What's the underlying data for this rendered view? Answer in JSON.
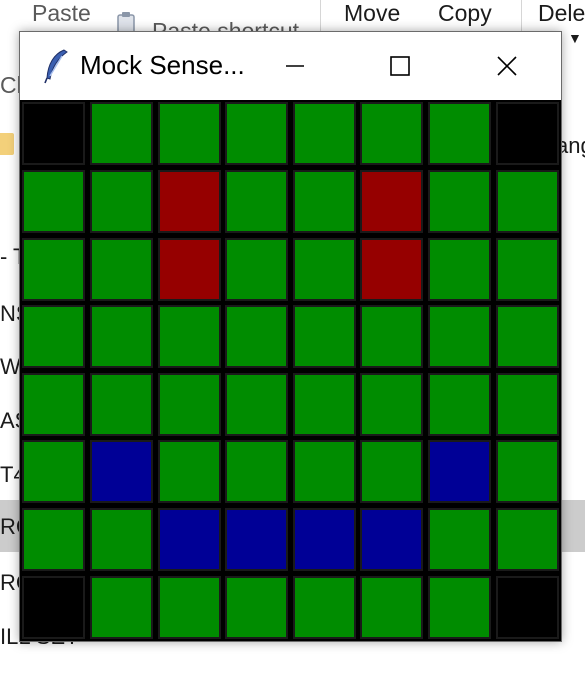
{
  "ribbon": {
    "paste_label": "Paste",
    "paste_shortcut_label": "Paste shortcut",
    "move_label": "Move",
    "copy_label": "Copy",
    "delete_label": "Dele",
    "clipboard_label": "Cli"
  },
  "file_list": {
    "right_fragment": "ang",
    "rows": [
      {
        "text": "- T",
        "selected": false
      },
      {
        "text": "NS",
        "selected": false
      },
      {
        "text": "W",
        "selected": false
      },
      {
        "text": "AS",
        "selected": false
      },
      {
        "text": "T4",
        "selected": false
      },
      {
        "text": "RC",
        "selected": true
      },
      {
        "text": "RG",
        "selected": false
      },
      {
        "text": "ILL SET",
        "selected": false
      }
    ]
  },
  "window": {
    "title": "Mock Sense...",
    "icon": "tk-feather-icon",
    "minimize_icon": "minimize-icon",
    "maximize_icon": "maximize-icon",
    "close_icon": "close-icon"
  },
  "led_matrix": {
    "rows": 8,
    "cols": 8,
    "palette": {
      "K": "#000000",
      "G": "#008c00",
      "R": "#960000",
      "B": "#000096"
    },
    "grid": [
      "KGGGGGGK",
      "GGRGGRGG",
      "GGRGGRGG",
      "GGGGGGGG",
      "GGGGGGGG",
      "GBGGGGBG",
      "GGBBBBGG",
      "KGGGGGGK"
    ]
  }
}
